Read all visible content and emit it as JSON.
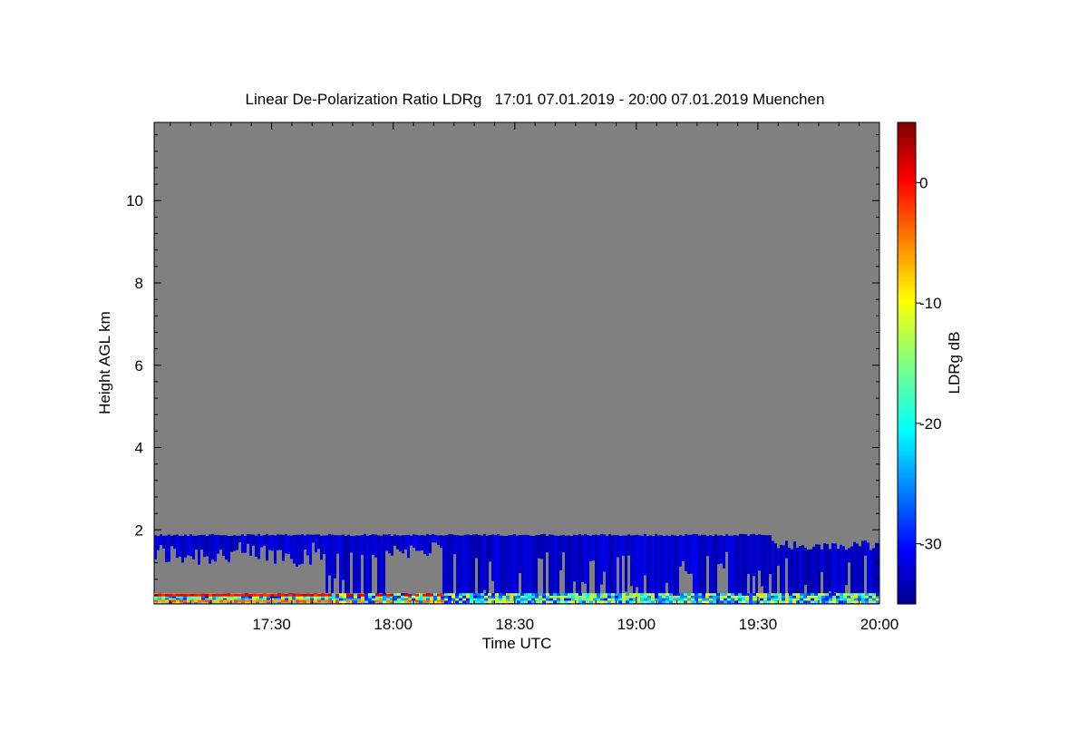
{
  "chart_data": {
    "type": "heatmap",
    "title": "Linear De-Polarization Ratio LDRg   17:01 07.01.2019 - 20:00 07.01.2019 Muenchen",
    "xlabel": "Time UTC",
    "ylabel": "Height AGL km",
    "x_range": [
      "17:01",
      "20:00"
    ],
    "x_ticks": [
      "17:30",
      "18:00",
      "18:30",
      "19:00",
      "19:30",
      "20:00"
    ],
    "ylim": [
      0.2,
      11.9
    ],
    "y_ticks": [
      2,
      4,
      6,
      8,
      10
    ],
    "colorbar": {
      "label": "LDRg dB",
      "range": [
        -35,
        5
      ],
      "ticks": [
        0,
        -10,
        -20,
        -30
      ],
      "colormap": "jet"
    },
    "background_color": "#808080",
    "cloud_layer": {
      "top_km": 1.9,
      "base_km": 0.2,
      "typical_ldr_db": -32,
      "color": "#0a1ee6"
    },
    "near_surface_band": {
      "height_km": [
        0.2,
        0.45
      ],
      "typical_ldr_db": 0,
      "time_range": [
        "17:01",
        "18:15"
      ]
    }
  }
}
